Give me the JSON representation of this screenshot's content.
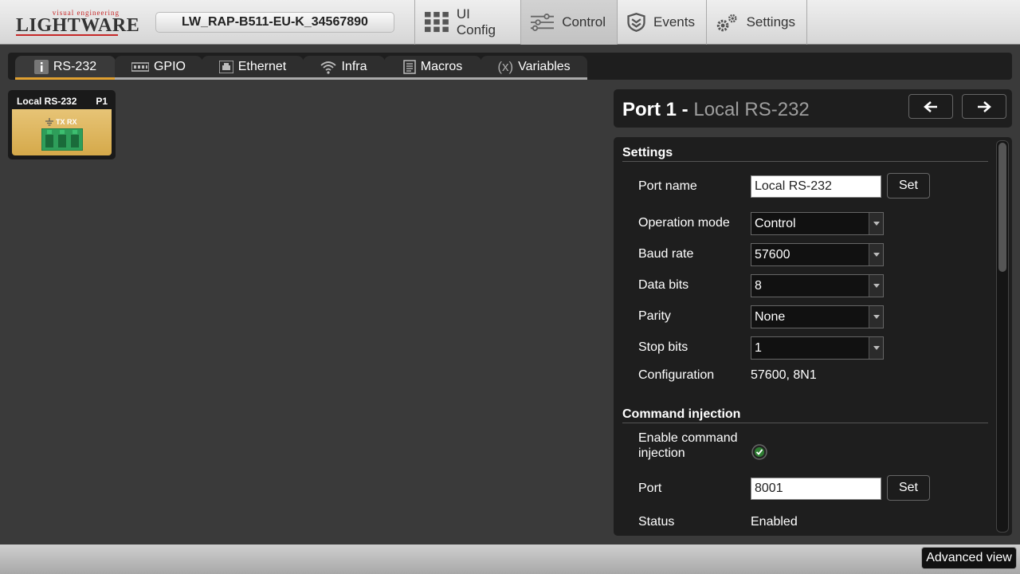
{
  "header": {
    "logo_tagline": "visual engineering",
    "logo_brand": "LIGHTWARE",
    "device_name": "LW_RAP-B511-EU-K_34567890",
    "tabs": [
      {
        "label": "UI Config",
        "icon": "grid-icon"
      },
      {
        "label": "Control",
        "icon": "sliders-icon",
        "active": true
      },
      {
        "label": "Events",
        "icon": "events-icon"
      },
      {
        "label": "Settings",
        "icon": "gears-icon"
      }
    ]
  },
  "subtabs": [
    {
      "label": "RS-232",
      "icon": "info-icon",
      "active": true
    },
    {
      "label": "GPIO",
      "icon": "gpio-icon"
    },
    {
      "label": "Ethernet",
      "icon": "ethernet-icon"
    },
    {
      "label": "Infra",
      "icon": "wifi-icon"
    },
    {
      "label": "Macros",
      "icon": "document-icon"
    },
    {
      "label": "Variables",
      "icon": "variable-icon",
      "icon_text": "(x)"
    }
  ],
  "port_tile": {
    "name": "Local RS-232",
    "port": "P1",
    "connector_labels": "TX RX",
    "accent_color": "#d9b05a"
  },
  "port_header": {
    "title": "Port 1",
    "separator": " - ",
    "subtitle": "Local RS-232"
  },
  "settings": {
    "title": "Settings",
    "port_name_label": "Port name",
    "port_name_value": "Local RS-232",
    "set_label": "Set",
    "operation_mode_label": "Operation mode",
    "operation_mode_value": "Control",
    "baud_rate_label": "Baud rate",
    "baud_rate_value": "57600",
    "data_bits_label": "Data bits",
    "data_bits_value": "8",
    "parity_label": "Parity",
    "parity_value": "None",
    "stop_bits_label": "Stop bits",
    "stop_bits_value": "1",
    "configuration_label": "Configuration",
    "configuration_value": "57600, 8N1"
  },
  "command_injection": {
    "title": "Command injection",
    "enable_label": "Enable command injection",
    "enabled": true,
    "port_label": "Port",
    "port_value": "8001",
    "set_label": "Set",
    "status_label": "Status",
    "status_value": "Enabled"
  },
  "footer": {
    "advanced_view_label": "Advanced view"
  }
}
